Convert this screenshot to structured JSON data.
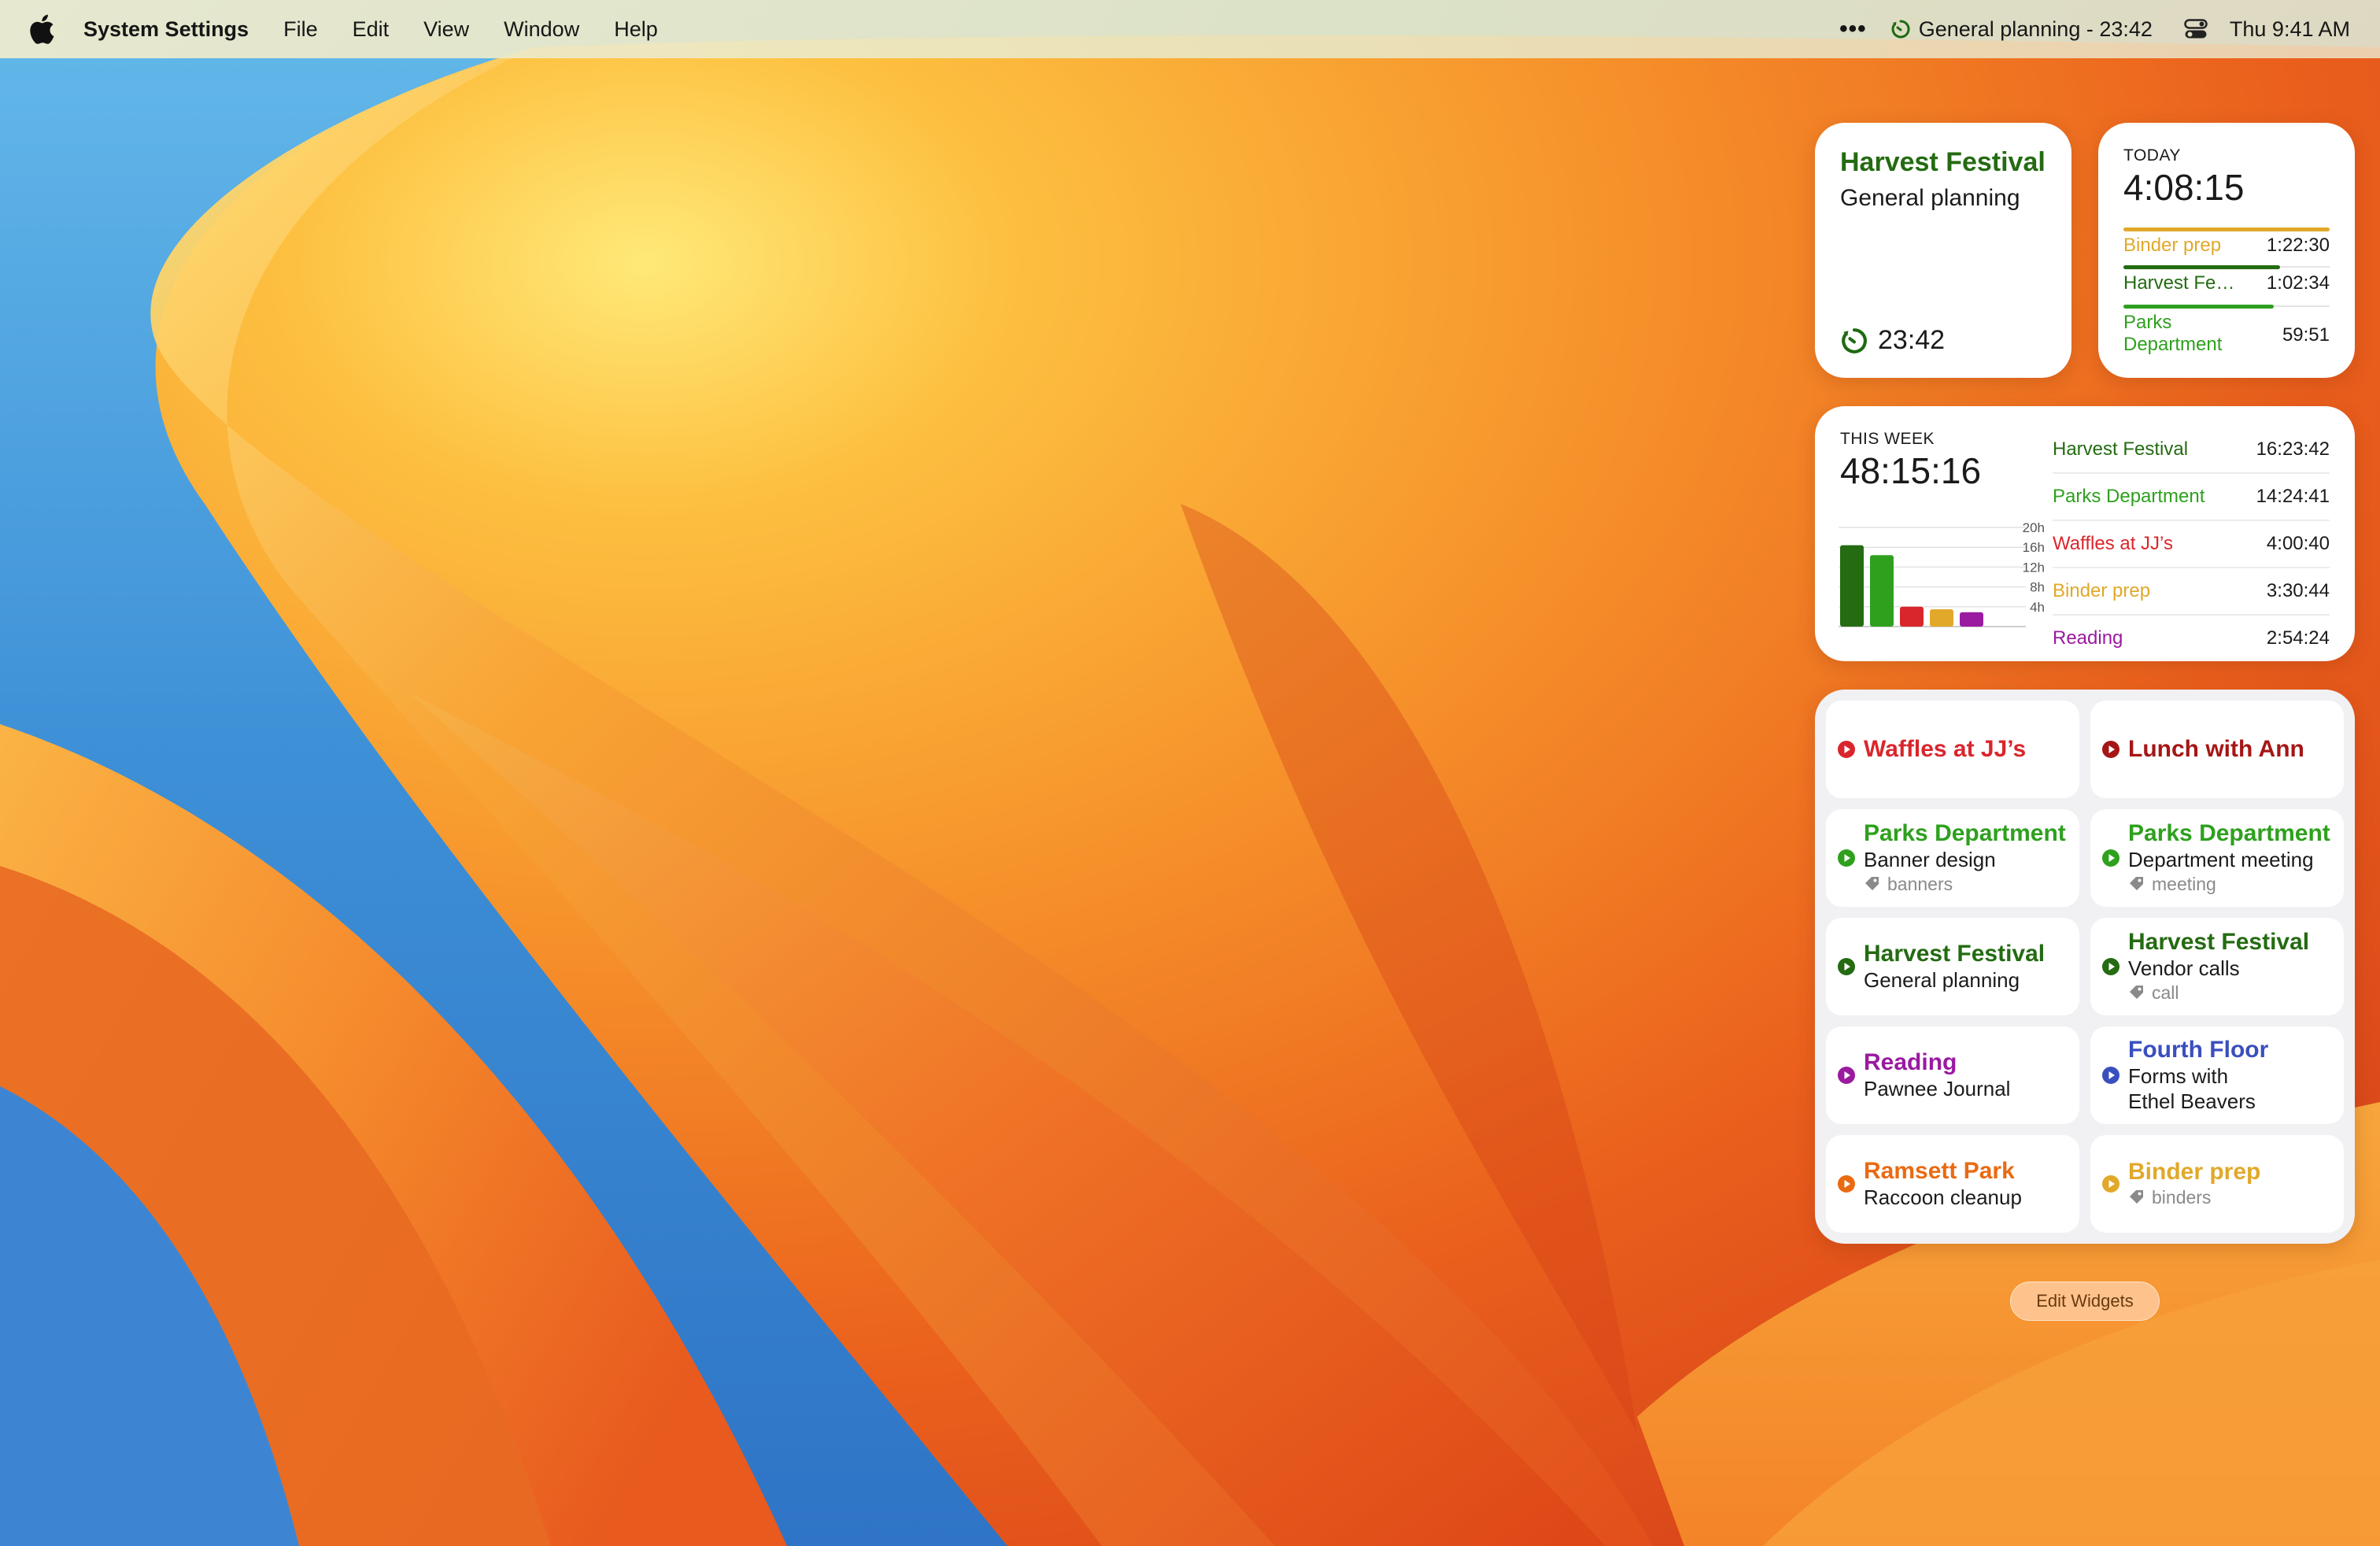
{
  "colors": {
    "harvest": "#246b12",
    "parks": "#2ea01e",
    "waffles": "#d9262c",
    "lunch": "#a51616",
    "binder": "#e1a82a",
    "reading": "#9a1aa0",
    "fourth_floor": "#3a4fbe",
    "ramsett": "#ea6a12",
    "gray_tag": "#8a8a8a"
  },
  "menubar": {
    "app_name": "System Settings",
    "items": [
      "File",
      "Edit",
      "View",
      "Window",
      "Help"
    ],
    "more": "•••",
    "timer_status": "General planning - 23:42",
    "clock": "Thu 9:41 AM"
  },
  "timer_widget": {
    "project": "Harvest Festival",
    "task": "General planning",
    "elapsed": "23:42"
  },
  "today_widget": {
    "caption": "TODAY",
    "total": "4:08:15",
    "rows": [
      {
        "label": "Binder prep",
        "value": "1:22:30",
        "fraction": 1.0
      },
      {
        "label": "Harvest Fe…",
        "value": "1:02:34",
        "fraction": 0.76
      },
      {
        "label": "Parks Department",
        "value": "59:51",
        "fraction": 0.73
      }
    ]
  },
  "week_widget": {
    "caption": "THIS WEEK",
    "total": "48:15:16",
    "rows": [
      {
        "label": "Harvest Festival",
        "value": "16:23:42"
      },
      {
        "label": "Parks Department",
        "value": "14:24:41"
      },
      {
        "label": "Waffles at JJ’s",
        "value": "4:00:40"
      },
      {
        "label": "Binder prep",
        "value": "3:30:44"
      },
      {
        "label": "Reading",
        "value": "2:54:24"
      }
    ]
  },
  "chart_data": {
    "type": "bar",
    "title": "",
    "categories": [
      "Harvest Festival",
      "Parks Department",
      "Waffles at JJ’s",
      "Binder prep",
      "Reading"
    ],
    "values": [
      16.4,
      14.4,
      4.0,
      3.5,
      2.9
    ],
    "units": "hours",
    "ylim": [
      0,
      20
    ],
    "yticks": [
      "20h",
      "16h",
      "12h",
      "8h",
      "4h"
    ],
    "ytick_values": [
      20,
      16,
      12,
      8,
      4
    ],
    "grid": true
  },
  "tiles": [
    {
      "title": "Waffles at JJ’s",
      "sub": "",
      "tag": "",
      "color_key": "waffles"
    },
    {
      "title": "Lunch with Ann",
      "sub": "",
      "tag": "",
      "color_key": "lunch"
    },
    {
      "title": "Parks Department",
      "sub": "Banner design",
      "tag": "banners",
      "color_key": "parks"
    },
    {
      "title": "Parks Department",
      "sub": "Department meeting",
      "tag": "meeting",
      "color_key": "parks"
    },
    {
      "title": "Harvest Festival",
      "sub": "General planning",
      "tag": "",
      "color_key": "harvest"
    },
    {
      "title": "Harvest Festival",
      "sub": "Vendor calls",
      "tag": "call",
      "color_key": "harvest"
    },
    {
      "title": "Reading",
      "sub": "Pawnee Journal",
      "tag": "",
      "color_key": "reading"
    },
    {
      "title": "Fourth Floor",
      "sub": "Forms with Ethel Beavers",
      "tag": "",
      "color_key": "fourth_floor"
    },
    {
      "title": "Ramsett Park",
      "sub": "Raccoon cleanup",
      "tag": "",
      "color_key": "ramsett"
    },
    {
      "title": "Binder prep",
      "sub": "",
      "tag": "binders",
      "color_key": "binder"
    }
  ],
  "edit_widgets_label": "Edit Widgets"
}
